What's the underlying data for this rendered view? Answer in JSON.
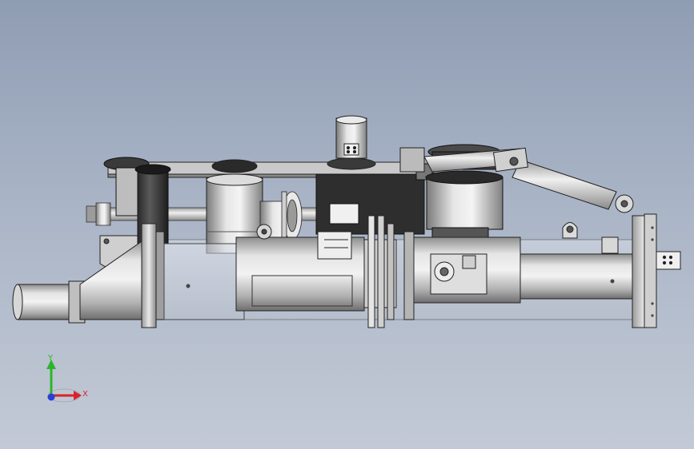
{
  "viewport": {
    "background_top": "#8f9db3",
    "background_bottom": "#c3cad6"
  },
  "triad": {
    "y_label": "Y",
    "x_label": "X",
    "y_color": "#2ab52a",
    "x_color": "#d8232a",
    "z_color": "#2a3fd8"
  },
  "model": {
    "icon": "cad-assembly-icon"
  }
}
